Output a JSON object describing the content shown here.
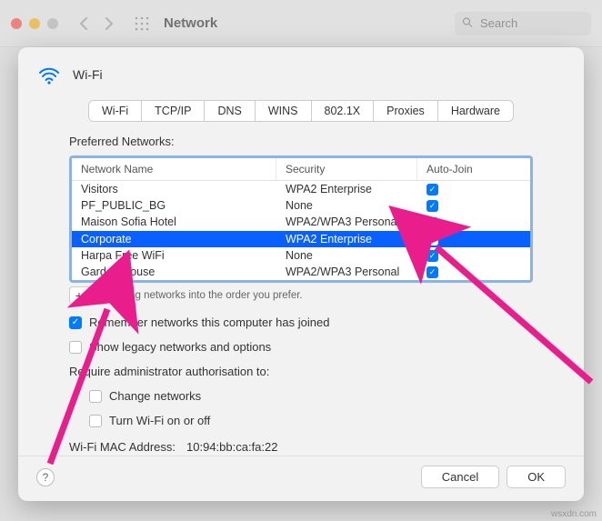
{
  "window": {
    "title": "Network",
    "search_placeholder": "Search"
  },
  "sheet": {
    "title": "Wi-Fi",
    "tabs": [
      "Wi-Fi",
      "TCP/IP",
      "DNS",
      "WINS",
      "802.1X",
      "Proxies",
      "Hardware"
    ],
    "active_tab_index": 0,
    "preferred_label": "Preferred Networks:",
    "columns": {
      "name": "Network Name",
      "security": "Security",
      "autojoin": "Auto-Join"
    },
    "networks": [
      {
        "name": "Visitors",
        "security": "WPA2 Enterprise",
        "autojoin": true,
        "selected": false
      },
      {
        "name": "PF_PUBLIC_BG",
        "security": "None",
        "autojoin": true,
        "selected": false
      },
      {
        "name": "Maison Sofia Hotel",
        "security": "WPA2/WPA3 Personal",
        "autojoin": true,
        "selected": false
      },
      {
        "name": "Corporate",
        "security": "WPA2 Enterprise",
        "autojoin": true,
        "selected": true
      },
      {
        "name": "Harpa Free WiFi",
        "security": "None",
        "autojoin": true,
        "selected": false
      },
      {
        "name": "Garden House",
        "security": "WPA2/WPA3 Personal",
        "autojoin": true,
        "selected": false
      }
    ],
    "drag_hint": "Drag networks into the order you prefer.",
    "remember_label": "Remember networks this computer has joined",
    "remember_checked": true,
    "legacy_label": "Show legacy networks and options",
    "legacy_checked": false,
    "auth_label": "Require administrator authorisation to:",
    "change_networks_label": "Change networks",
    "change_networks_checked": false,
    "turn_wifi_label": "Turn Wi-Fi on or off",
    "turn_wifi_checked": false,
    "mac_label": "Wi-Fi MAC Address:",
    "mac_value": "10:94:bb:ca:fa:22",
    "cancel_label": "Cancel",
    "ok_label": "OK"
  },
  "watermark": "wsxdn.com",
  "annotations": {
    "arrow_color": "#e91e8c"
  }
}
